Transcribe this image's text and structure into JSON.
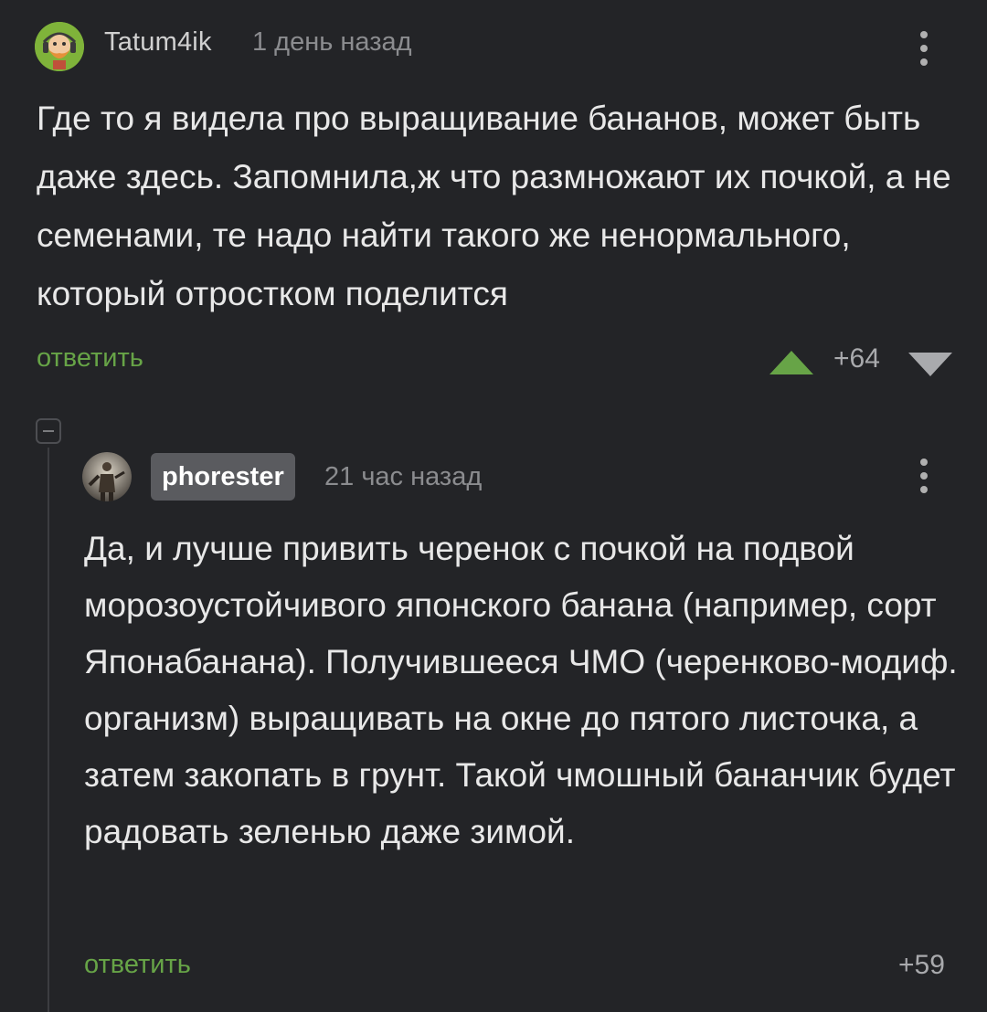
{
  "comments": [
    {
      "author": "Tatum4ik",
      "time": "1 день назад",
      "text": "Где то я видела про выращивание бананов, может быть даже здесь. Запомнила,ж что размножают их почкой, а не семенами, те надо найти такого же ненормального, который отростком поделится",
      "reply_label": "ответить",
      "rating": "+64",
      "avatar_icon": "bearded-man-avatar-icon"
    },
    {
      "author": "phorester",
      "time": "21 час назад",
      "text": "Да, и лучше привить черенок с почкой на подвой морозоустойчивого японского банана (например, сорт Японабанана). Получившееся ЧМО (черенково-модиф. организм) выращивать на окне до пятого листочка, а затем закопать в грунт. Такой чмошный бананчик будет радовать зеленью даже зимой.",
      "reply_label": "ответить",
      "rating": "+59",
      "avatar_icon": "soldier-avatar-icon"
    }
  ],
  "colors": {
    "background": "#232427",
    "accent_green": "#67a447",
    "muted_text": "#8b8c8f",
    "author_badge": "#5a5b5f"
  }
}
